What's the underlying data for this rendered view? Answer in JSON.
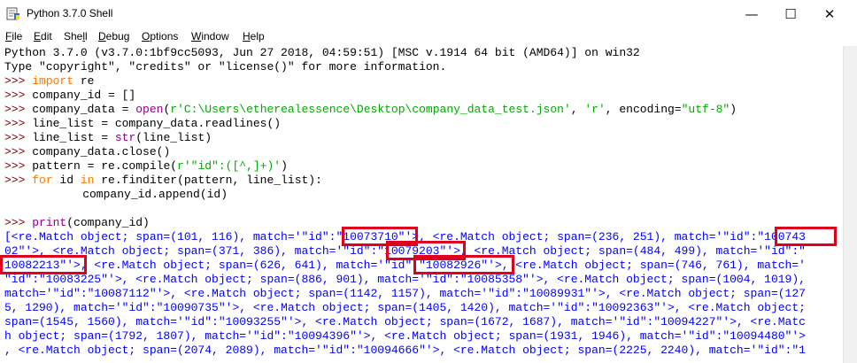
{
  "window": {
    "title": "Python 3.7.0 Shell",
    "icons": {
      "app": "python-idle-icon",
      "minimize": "minimize-icon",
      "maximize": "maximize-icon",
      "close": "close-icon"
    },
    "minimize_glyph": "—",
    "maximize_glyph": "☐",
    "close_glyph": "✕"
  },
  "menu": {
    "file": {
      "ul": "F",
      "rest": "ile"
    },
    "edit": {
      "ul": "E",
      "rest": "dit"
    },
    "shell": {
      "pre": "She",
      "ul": "l",
      "rest": "l"
    },
    "debug": {
      "ul": "D",
      "rest": "ebug"
    },
    "options": {
      "ul": "O",
      "rest": "ptions"
    },
    "window": {
      "ul": "W",
      "rest": "indow"
    },
    "help": {
      "ul": "H",
      "rest": "elp"
    }
  },
  "console": {
    "prompt": ">>>",
    "banner1": "Python 3.7.0 (v3.7.0:1bf9cc5093, Jun 27 2018, 04:59:51) [MSC v.1914 64 bit (AMD64)] on win32",
    "banner2": "Type \"copyright\", \"credits\" or \"license()\" for more information.",
    "l3": {
      "kw": "import",
      "rest": " re"
    },
    "l4": "company_id = []",
    "l5": {
      "a": "company_data = ",
      "fn": "open",
      "b": "(",
      "s1": "r'C:\\Users\\etherealessence\\Desktop\\company_data_test.json'",
      "c": ", ",
      "s2": "'r'",
      "d": ", encoding=",
      "s3": "\"utf-8\"",
      "e": ")"
    },
    "l6": "line_list = company_data.readlines()",
    "l7": {
      "a": "line_list = ",
      "fn": "str",
      "b": "(line_list)"
    },
    "l8": "company_data.close()",
    "l9": {
      "a": "pattern = re.compile(",
      "s": "r'\"id\":([^,]+)'",
      "b": ")"
    },
    "l10": {
      "kw1": "for",
      "a": " id ",
      "kw2": "in",
      "b": " re.finditer(pattern, line_list):"
    },
    "l11": "    company_id.append(id)",
    "l12": {
      "fn": "print",
      "b": "(company_id)"
    },
    "output": [
      "[<re.Match object; span=(101, 116), match='\"id\":\"10073710\"'>, <re.Match object; span=(236, 251), match='\"id\":\"100743",
      "02\"'>, <re.Match object; span=(371, 386), match='\"id\":\"10079203\"'>, <re.Match object; span=(484, 499), match='\"id\":\"",
      "10082213\"'>, <re.Match object; span=(626, 641), match='\"id\":\"10082926\"'>, <re.Match object; span=(746, 761), match='",
      "\"id\":\"10083225\"'>, <re.Match object; span=(886, 901), match='\"id\":\"10085358\"'>, <re.Match object; span=(1004, 1019),",
      "match='\"id\":\"10087112\"'>, <re.Match object; span=(1142, 1157), match='\"id\":\"10089931\"'>, <re.Match object; span=(127",
      "5, 1290), match='\"id\":\"10090735\"'>, <re.Match object; span=(1405, 1420), match='\"id\":\"10092363\"'>, <re.Match object;",
      "span=(1545, 1560), match='\"id\":\"10093255\"'>, <re.Match object; span=(1672, 1687), match='\"id\":\"10094227\"'>, <re.Matc",
      "h object; span=(1792, 1807), match='\"id\":\"10094396\"'>, <re.Match object; span=(1931, 1946), match='\"id\":\"10094480\"'>",
      ", <re.Match object; span=(2074, 2089), match='\"id\":\"10094666\"'>, <re.Match object; span=(2225, 2240), match='\"id\":\"1"
    ]
  },
  "highlight_color": "#e0001b"
}
